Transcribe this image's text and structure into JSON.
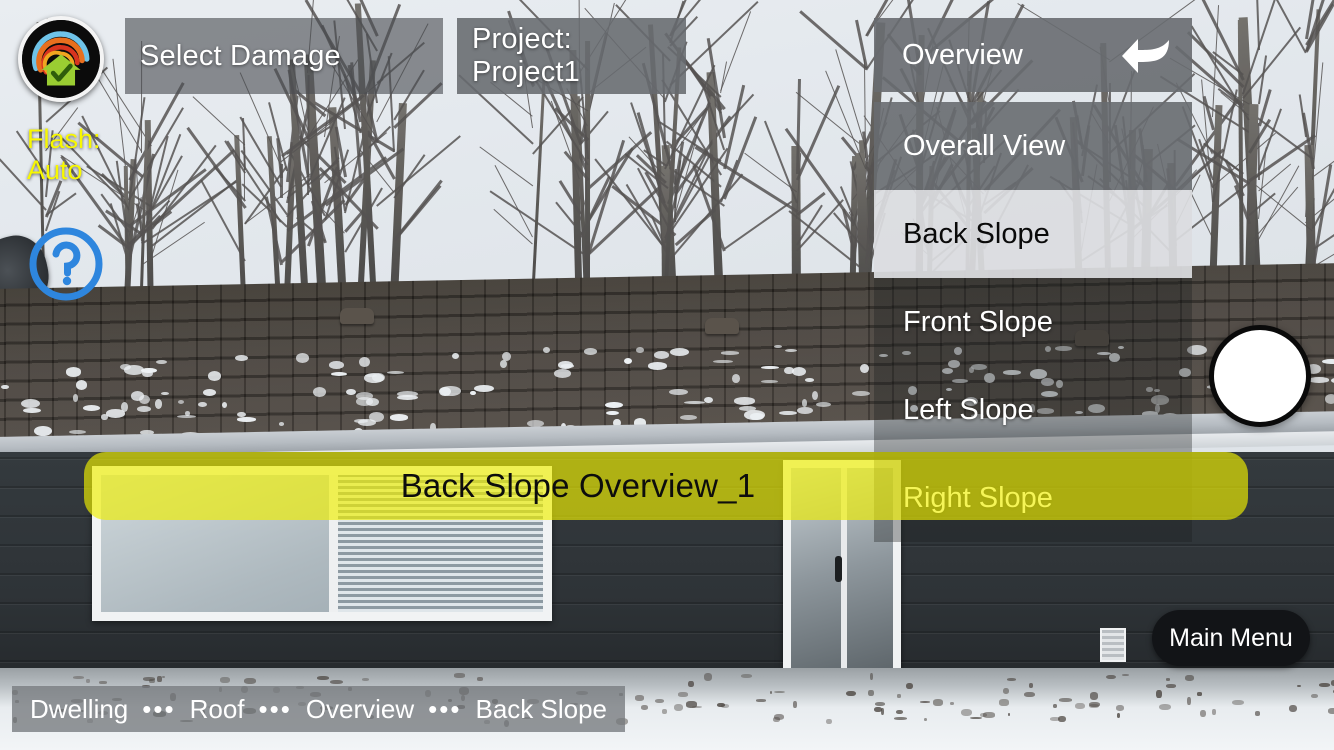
{
  "app": {
    "logo_icon": "roof-inspection-logo-icon",
    "screen_title": "Select Damage"
  },
  "toolbar": {
    "select_damage_label": "Select Damage",
    "project_label": "Project: Project1"
  },
  "camera": {
    "flash_label": "Flash:",
    "flash_value": "Auto",
    "help_icon": "question-mark-circle-icon",
    "shutter_icon": "camera-shutter-icon"
  },
  "menu": {
    "header_title": "Overview",
    "back_icon": "curved-back-arrow-icon",
    "items": [
      {
        "label": "Overall View",
        "state": "solid"
      },
      {
        "label": "Back Slope",
        "state": "selected"
      },
      {
        "label": "Front Slope",
        "state": "ghost"
      },
      {
        "label": "Left Slope",
        "state": "ghost"
      },
      {
        "label": "Right Slope",
        "state": "ghost"
      }
    ]
  },
  "caption": {
    "text": "Back Slope Overview_1"
  },
  "main_menu": {
    "label": "Main Menu"
  },
  "breadcrumb": {
    "separator": "•••",
    "items": [
      {
        "label": "Dwelling"
      },
      {
        "label": "Roof"
      },
      {
        "label": "Overview"
      },
      {
        "label": "Back Slope"
      }
    ]
  },
  "colors": {
    "flash_yellow": "#f8f800",
    "caption_yellow": "#f0f000",
    "help_blue": "#2e86de",
    "panel_gray": "#686c70",
    "selected_gray": "#dbdde0",
    "main_menu_dark": "#121417"
  }
}
